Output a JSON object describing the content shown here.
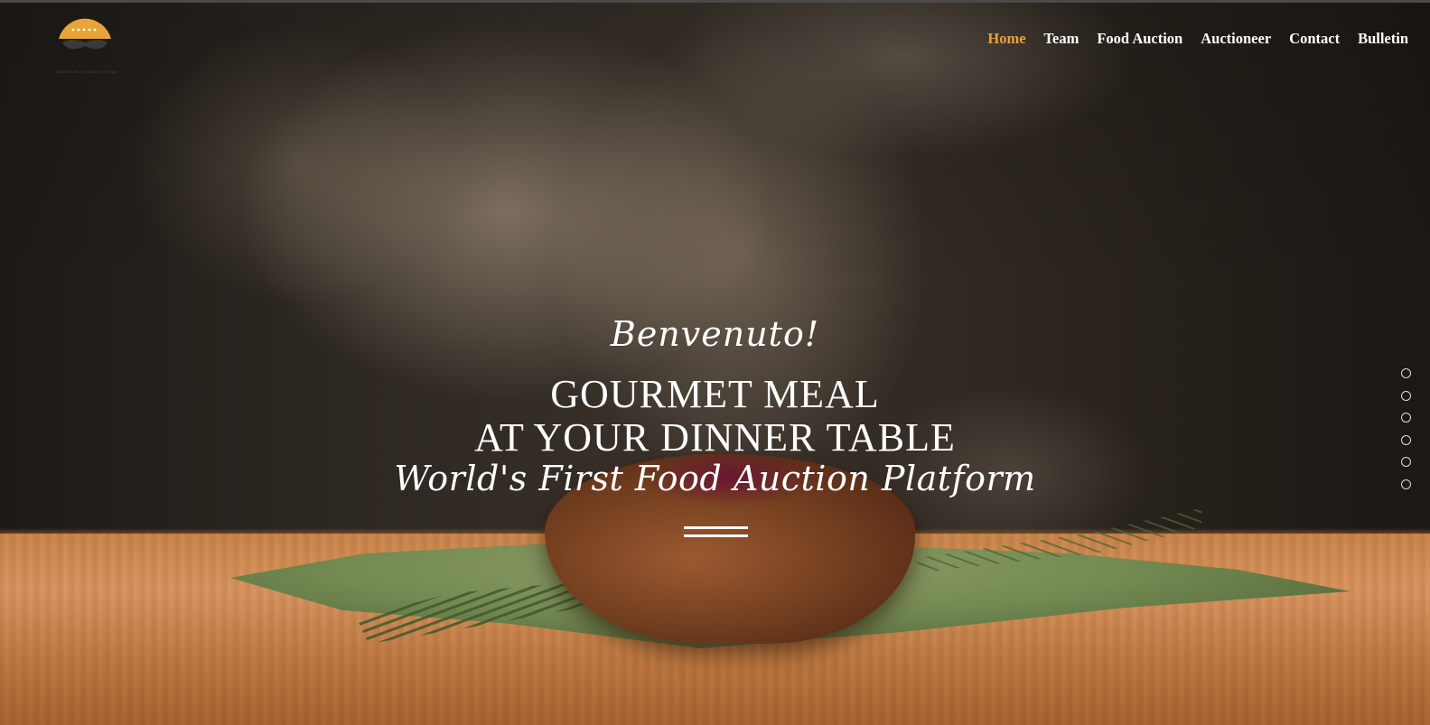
{
  "brand": {
    "name": "Hungry Top",
    "tagline": "FOOD THAT WILL CHOOSE YOUR TABLE",
    "accent_color": "#e8a33a",
    "logo_icon": "sun-mustache-logo-icon"
  },
  "nav": {
    "items": [
      {
        "label": "Home",
        "active": true
      },
      {
        "label": "Team",
        "active": false
      },
      {
        "label": "Food Auction",
        "active": false
      },
      {
        "label": "Auctioneer",
        "active": false
      },
      {
        "label": "Contact",
        "active": false
      },
      {
        "label": "Bulletin",
        "active": false
      }
    ]
  },
  "hero": {
    "greeting": "Benvenuto!",
    "headline_line1": "GOURMET MEAL",
    "headline_line2": "AT YOUR DINNER TABLE",
    "tagline": "World's First Food Auction Platform",
    "background_image": "steaming-steak-on-banana-leaf"
  },
  "slider": {
    "dot_count": 6,
    "active_index": 0
  }
}
